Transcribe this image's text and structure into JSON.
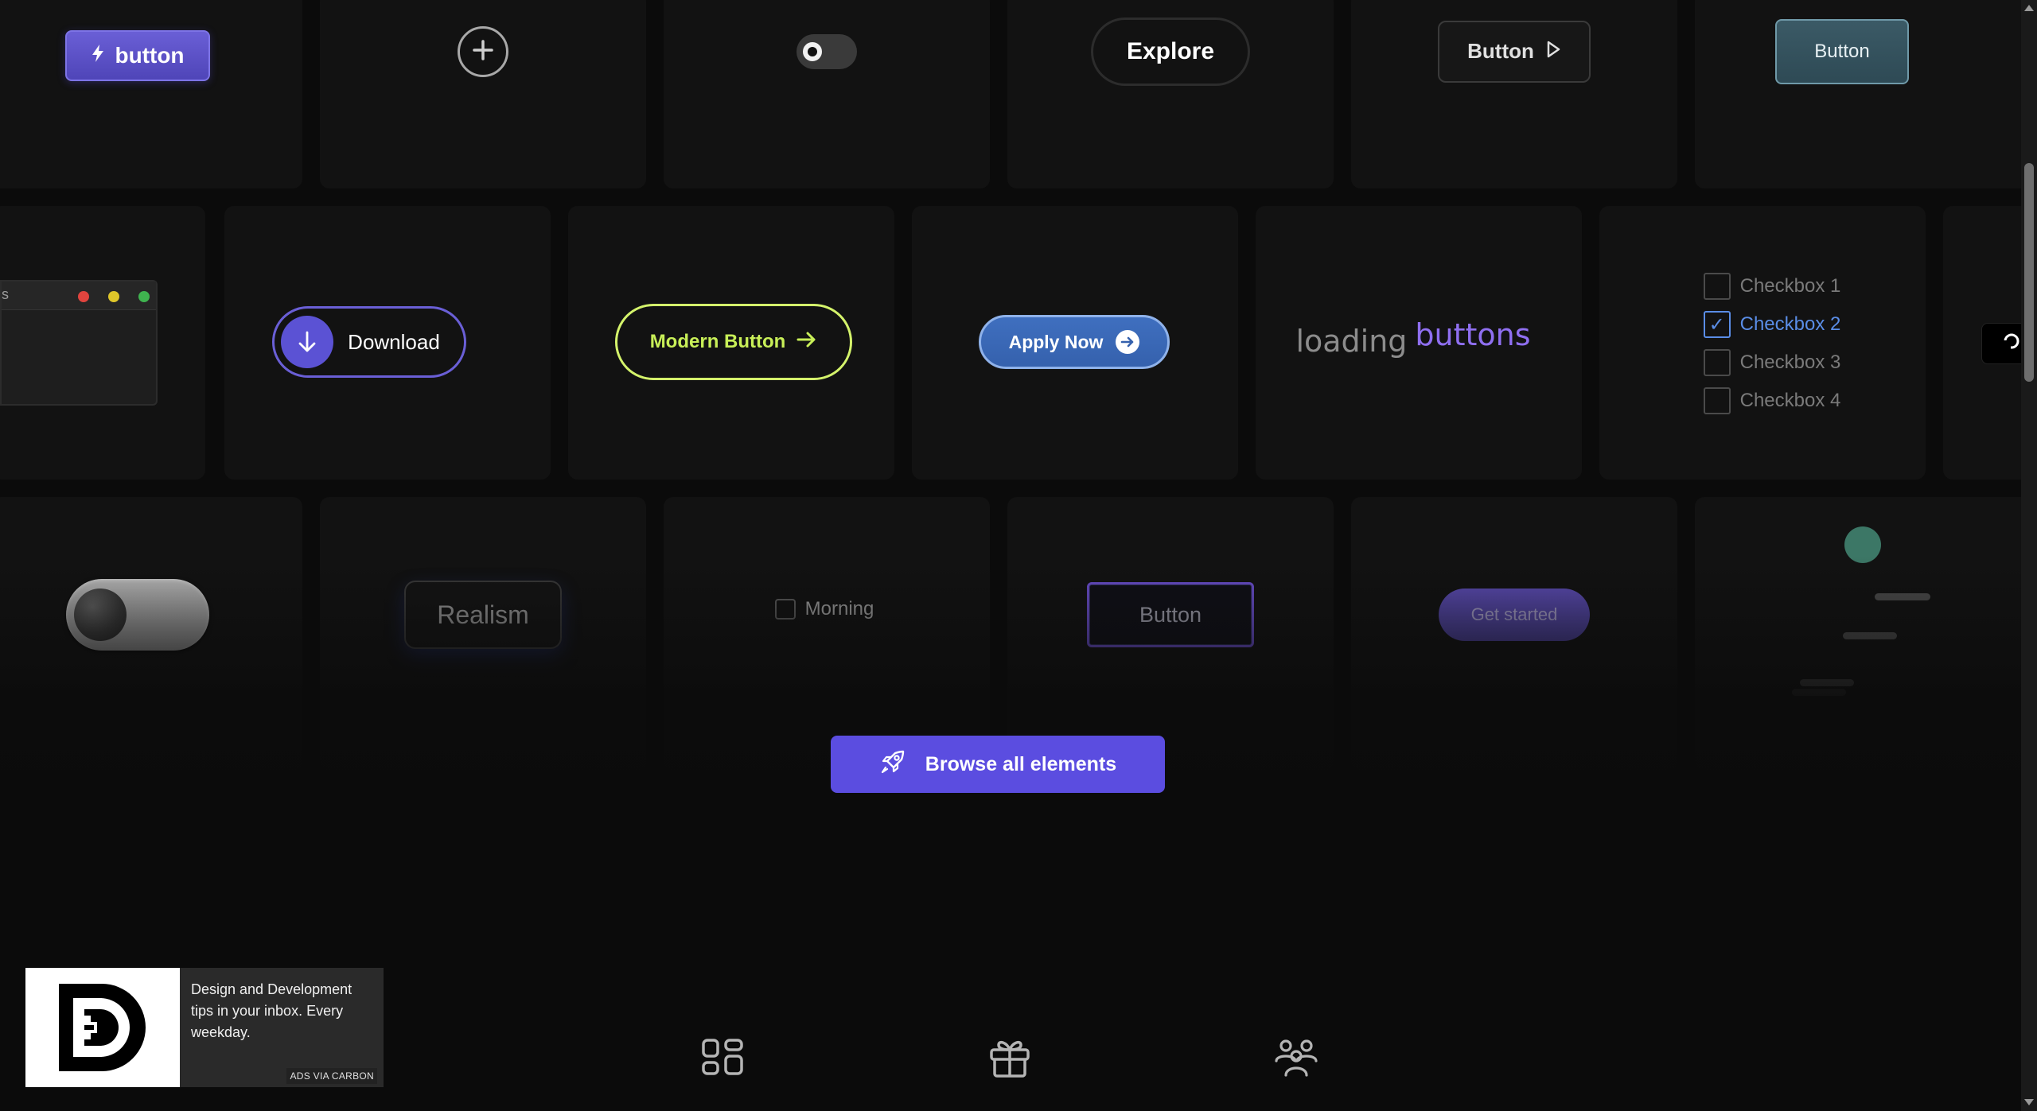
{
  "row1": {
    "bolt_button_label": "button",
    "explore_label": "Explore",
    "play_button_label": "Button",
    "teal_button_label": "Button"
  },
  "row2": {
    "mac_window_fragment": "s",
    "download_label": "Download",
    "modern_button_label": "Modern Button",
    "apply_now_label": "Apply Now",
    "loading_word": "loading",
    "buttons_word": "buttons",
    "checkboxes": [
      {
        "label": "Checkbox 1",
        "checked": false
      },
      {
        "label": "Checkbox 2",
        "checked": true
      },
      {
        "label": "Checkbox 3",
        "checked": false
      },
      {
        "label": "Checkbox 4",
        "checked": false
      }
    ]
  },
  "row3": {
    "realism_label": "Realism",
    "morning_label": "Morning",
    "outline_button_label": "Button",
    "get_started_label": "Get started"
  },
  "browse_button_label": "Browse all elements",
  "ad": {
    "text": "Design and Development tips in your inbox. Every weekday.",
    "via_label": "ADS VIA CARBON"
  },
  "bottom_nav": [
    "elements-grid-icon",
    "gift-icon",
    "community-icon"
  ],
  "colors": {
    "accent_purple": "#5b4de0",
    "lime": "#c8ef58",
    "checkbox_blue": "#5a8de6",
    "background": "#0b0b0b"
  }
}
